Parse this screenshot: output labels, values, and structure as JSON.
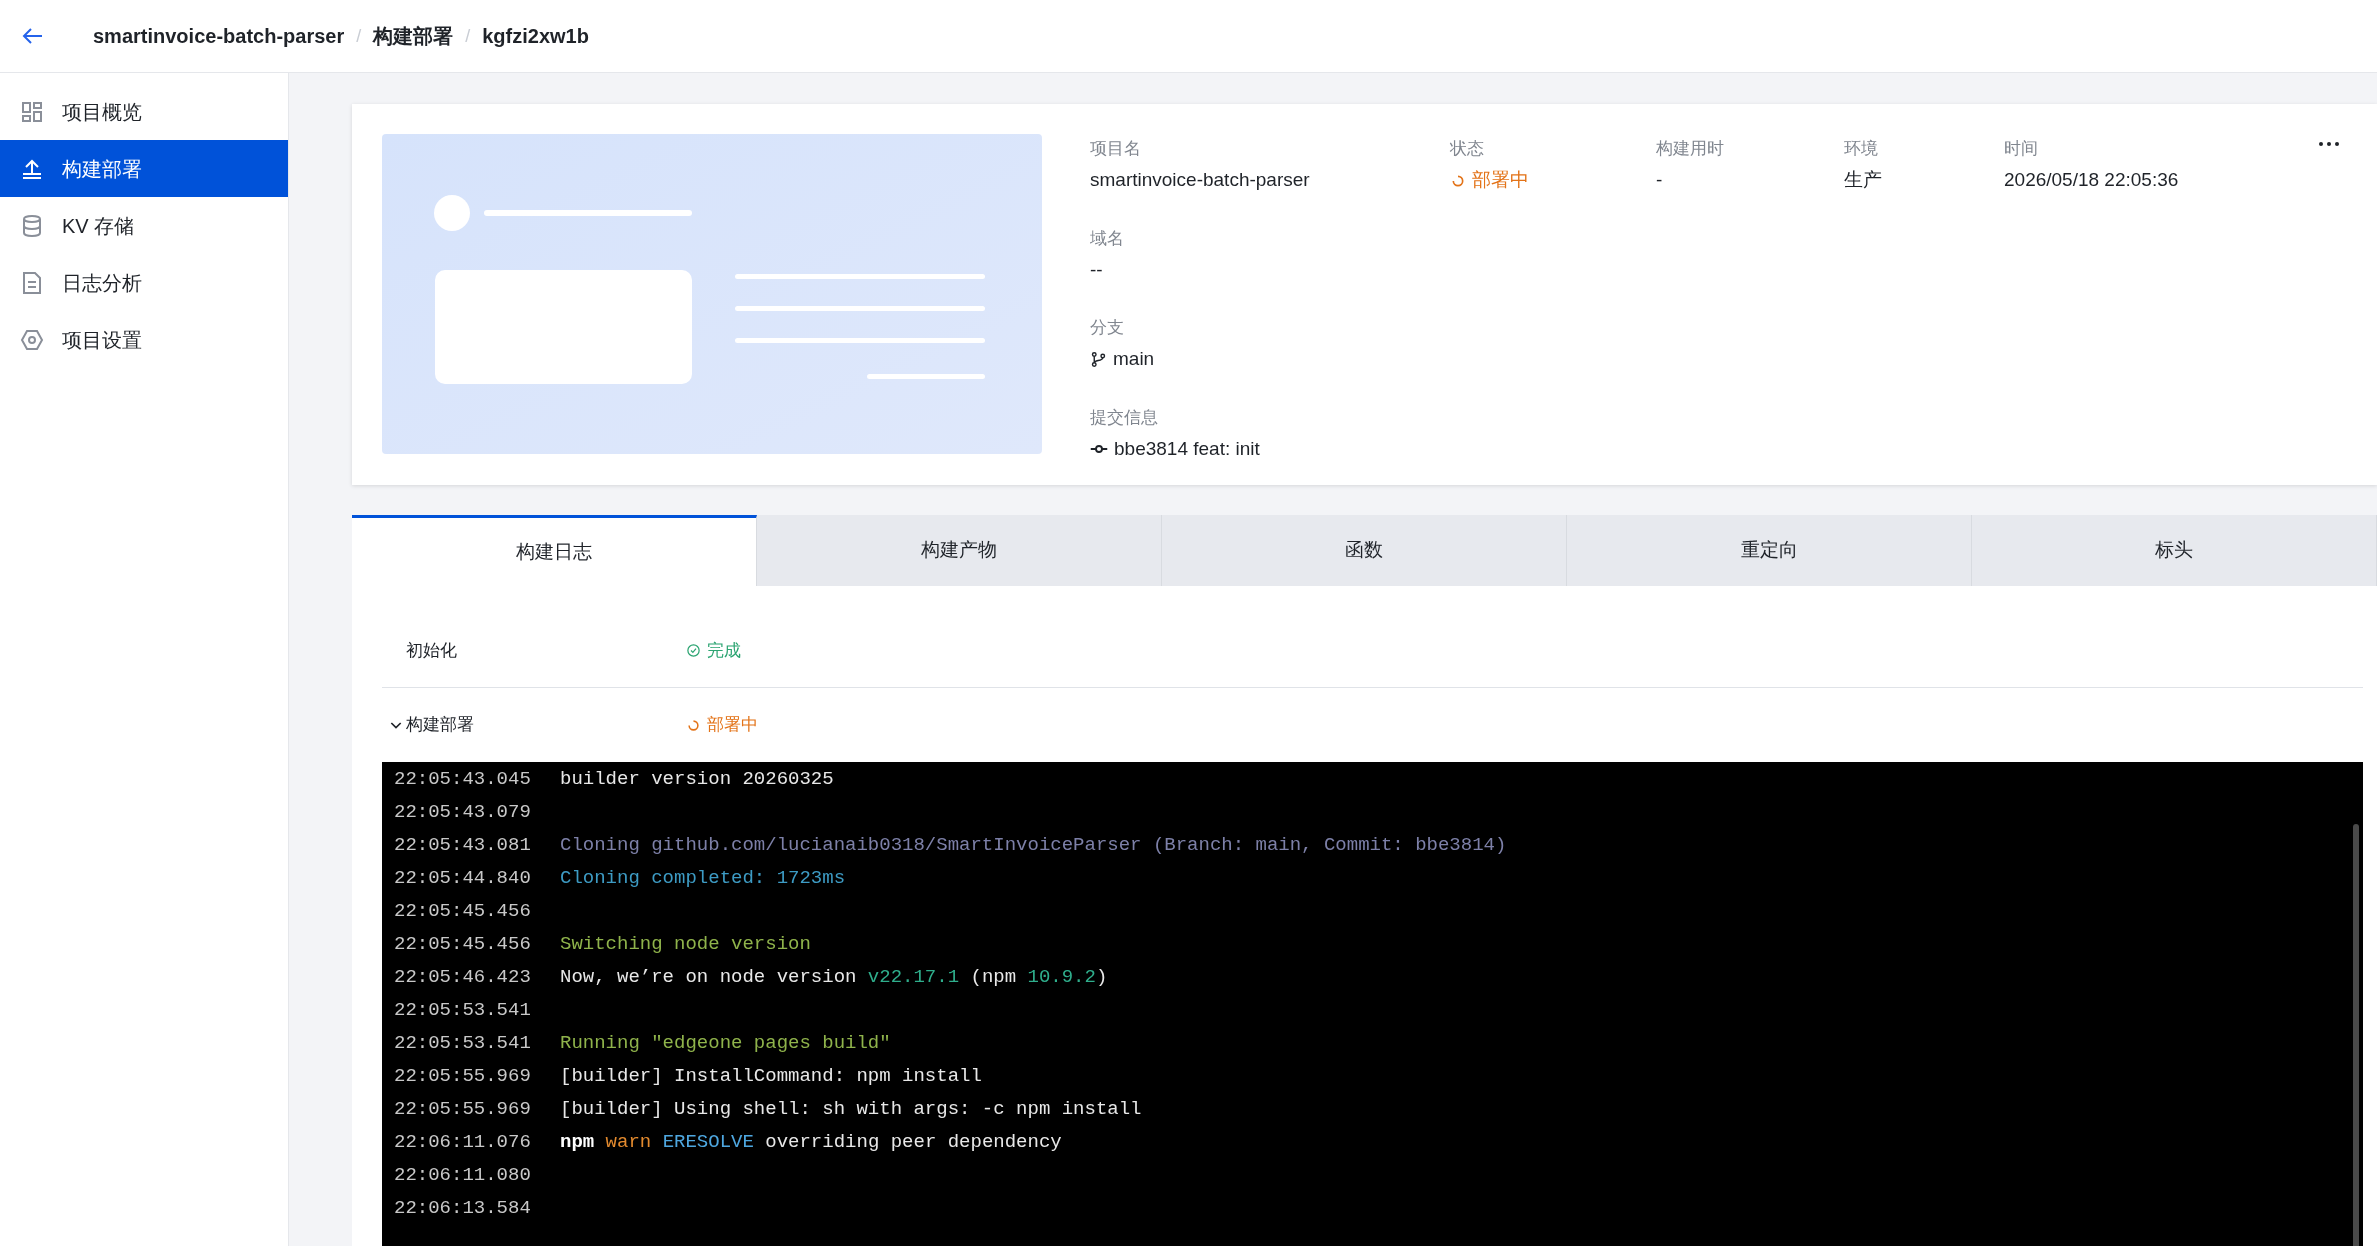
{
  "breadcrumb": {
    "separator": "/",
    "items": [
      "smartinvoice-batch-parser",
      "构建部署",
      "kgfzi2xw1b"
    ]
  },
  "sidebar": {
    "items": [
      {
        "label": "项目概览",
        "selected": false
      },
      {
        "label": "构建部署",
        "selected": true
      },
      {
        "label": "KV 存储",
        "selected": false
      },
      {
        "label": "日志分析",
        "selected": false
      },
      {
        "label": "项目设置",
        "selected": false
      }
    ]
  },
  "deployment": {
    "summary": [
      {
        "label": "项目名",
        "value": "smartinvoice-batch-parser",
        "kind": "text"
      },
      {
        "label": "状态",
        "value": "部署中",
        "kind": "running"
      },
      {
        "label": "构建用时",
        "value": "-",
        "kind": "text"
      },
      {
        "label": "环境",
        "value": "生产",
        "kind": "text"
      },
      {
        "label": "时间",
        "value": "2026/05/18 22:05:36",
        "kind": "text"
      }
    ],
    "details": [
      {
        "label": "域名",
        "value": "--",
        "kind": "text"
      },
      {
        "label": "分支",
        "value": "main",
        "kind": "branch"
      },
      {
        "label": "提交信息",
        "value": "bbe3814 feat: init",
        "kind": "commit"
      }
    ]
  },
  "tabs": [
    {
      "label": "构建日志",
      "selected": true
    },
    {
      "label": "构建产物",
      "selected": false
    },
    {
      "label": "函数",
      "selected": false
    },
    {
      "label": "重定向",
      "selected": false
    },
    {
      "label": "标头",
      "selected": false
    }
  ],
  "steps": [
    {
      "name": "初始化",
      "status_text": "完成",
      "kind": "done"
    },
    {
      "name": "构建部署",
      "status_text": "部署中",
      "kind": "running",
      "expanded": true
    }
  ],
  "log": [
    {
      "time": "22:05:43.045",
      "segments": [
        {
          "text": "builder version 20260325",
          "kind": "plain"
        }
      ]
    },
    {
      "time": "22:05:43.079"
    },
    {
      "time": "22:05:43.081",
      "segments": [
        {
          "text": "Cloning github.com/lucianaib0318/SmartInvoiceParser (Branch: main, Commit: bbe3814)",
          "kind": "muted"
        }
      ]
    },
    {
      "time": "22:05:44.840",
      "segments": [
        {
          "text": "Cloning completed: 1723ms",
          "kind": "info"
        }
      ]
    },
    {
      "time": "22:05:45.456"
    },
    {
      "time": "22:05:45.456",
      "segments": [
        {
          "text": "Switching node version",
          "kind": "success"
        }
      ]
    },
    {
      "time": "22:05:46.423",
      "segments": [
        {
          "text": "Now, we’re on node version ",
          "kind": "plain"
        },
        {
          "text": "v22.17.1",
          "kind": "version"
        },
        {
          "text": " (npm ",
          "kind": "plain"
        },
        {
          "text": "10.9.2",
          "kind": "version"
        },
        {
          "text": ")",
          "kind": "plain"
        }
      ]
    },
    {
      "time": "22:05:53.541"
    },
    {
      "time": "22:05:53.541",
      "segments": [
        {
          "text": "Running ″edgeone pages build″",
          "kind": "success"
        }
      ]
    },
    {
      "time": "22:05:55.969",
      "segments": [
        {
          "text": "[builder] InstallCommand: npm install",
          "kind": "plain"
        }
      ]
    },
    {
      "time": "22:05:55.969",
      "segments": [
        {
          "text": "[builder] Using shell: sh with args: -c npm install",
          "kind": "plain"
        }
      ]
    },
    {
      "time": "22:06:11.076",
      "segments": [
        {
          "text": "npm",
          "kind": "bold"
        },
        {
          "text": " warn",
          "kind": "warn"
        },
        {
          "text": " ERESOLVE",
          "kind": "code"
        },
        {
          "text": " overriding peer dependency",
          "kind": "plain"
        }
      ]
    },
    {
      "time": "22:06:11.080"
    },
    {
      "time": "22:06:13.584"
    }
  ]
}
